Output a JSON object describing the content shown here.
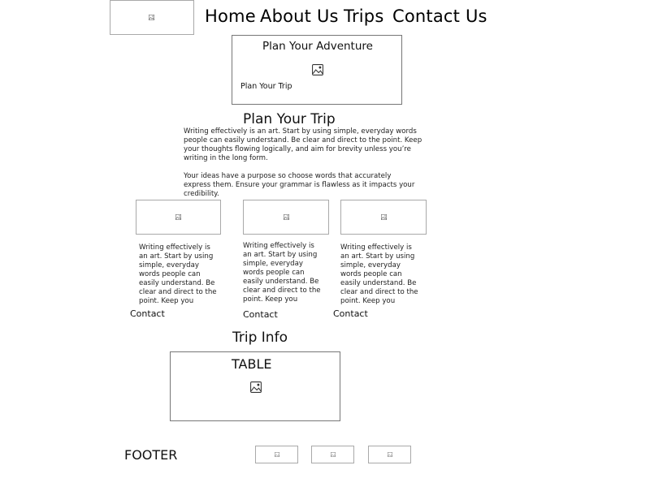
{
  "nav": {
    "items": [
      "Home",
      "About Us",
      "Trips",
      "Contact Us"
    ]
  },
  "hero": {
    "title": "Plan Your Adventure",
    "subtitle": "Plan Your Trip"
  },
  "section": {
    "title": "Plan Your Trip",
    "paragraph1": "Writing effectively is an art. Start by using simple, everyday words people can easily understand. Be clear and direct to the point. Keep your thoughts flowing logically, and aim for brevity unless you’re writing in the long form.",
    "paragraph2": "Your ideas have a purpose so choose words that accurately express them. Ensure your grammar is flawless as it impacts your credibility."
  },
  "cards": [
    {
      "text": "Writing effectively is an art. Start by using simple, everyday words people can easily understand. Be clear and direct to the point. Keep you",
      "link": "Contact"
    },
    {
      "text": "Writing effectively is an art. Start by using simple, everyday words people can easily understand. Be clear and direct to the point. Keep you",
      "link": "Contact"
    },
    {
      "text": "Writing effectively is an art. Start by using simple, everyday words people can easily understand. Be clear and direct to the point. Keep you",
      "link": "Contact"
    }
  ],
  "trip_info": {
    "title": "Trip Info",
    "table_label": "TABLE"
  },
  "footer": {
    "label": "FOOTER"
  },
  "icons": {
    "placeholder": "image-placeholder-icon"
  },
  "colors": {
    "border": "#a9a9a9",
    "text": "#111111",
    "background": "#ffffff"
  }
}
